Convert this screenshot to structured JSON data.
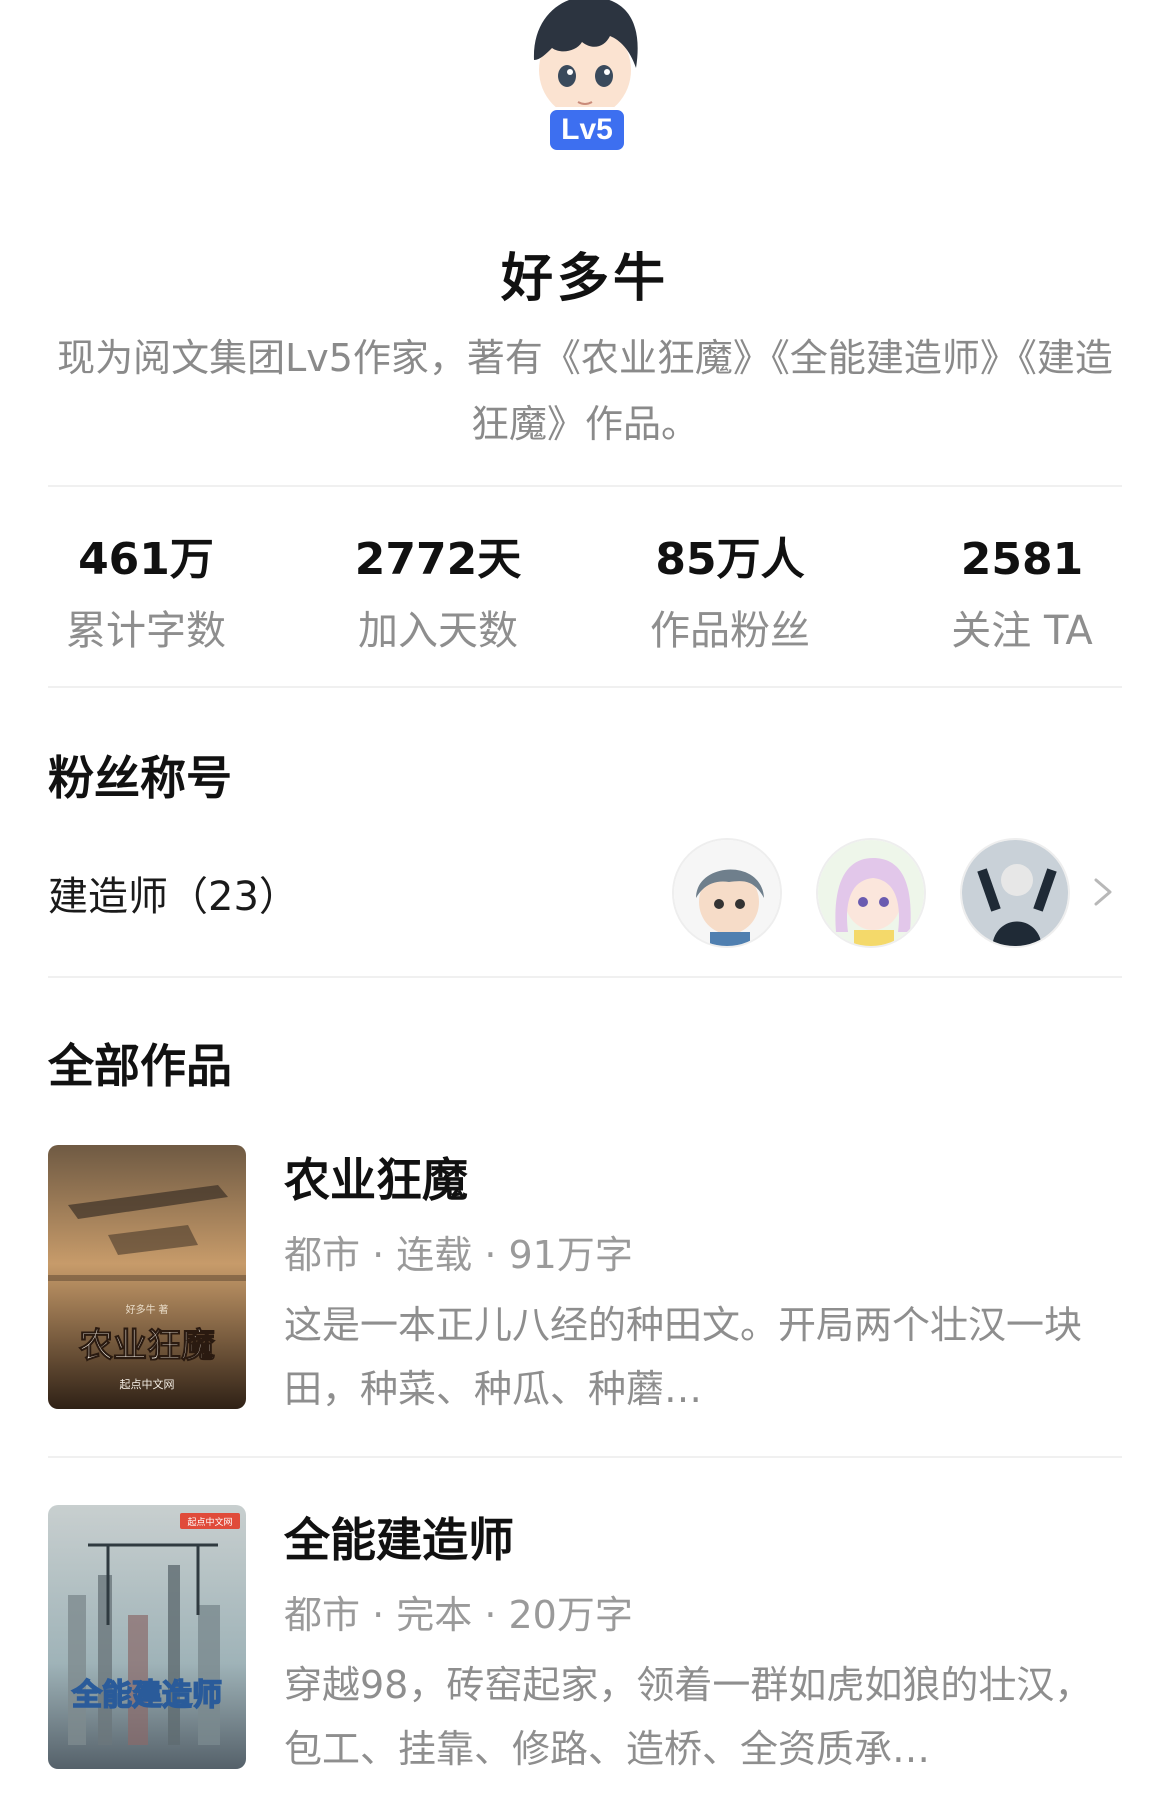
{
  "author": {
    "level": "Lv5",
    "name": "好多牛",
    "bio": "现为阅文集团Lv5作家，著有《农业狂魔》《全能建造师》《建造狂魔》作品。"
  },
  "stats": [
    {
      "value": "461万",
      "label": "累计字数"
    },
    {
      "value": "2772天",
      "label": "加入天数"
    },
    {
      "value": "85万人",
      "label": "作品粉丝"
    },
    {
      "value": "2581",
      "label": "关注 TA"
    }
  ],
  "fan_section": {
    "title": "粉丝称号",
    "label": "建造师（23）"
  },
  "works_section": {
    "title": "全部作品"
  },
  "works": [
    {
      "title": "农业狂魔",
      "meta": "都市 · 连载 · 91万字",
      "desc": "这是一本正儿八经的种田文。开局两个壮汉一块田，种菜、种瓜、种蘑…",
      "cover": {
        "author": "好多牛 著",
        "title": "农业狂魔",
        "publisher": "起点中文网"
      }
    },
    {
      "title": "全能建造师",
      "meta": "都市 · 完本 · 20万字",
      "desc": "穿越98，砖窑起家，领着一群如虎如狼的壮汉，包工、挂靠、修路、造桥、全资质承…",
      "cover": {
        "badge": "起点中文网",
        "title": "全能建造师"
      }
    }
  ],
  "colors": {
    "accent": "#3d6ff0",
    "text_primary": "#111111",
    "text_secondary": "#8e8e8e",
    "divider": "#f0f0f0"
  }
}
